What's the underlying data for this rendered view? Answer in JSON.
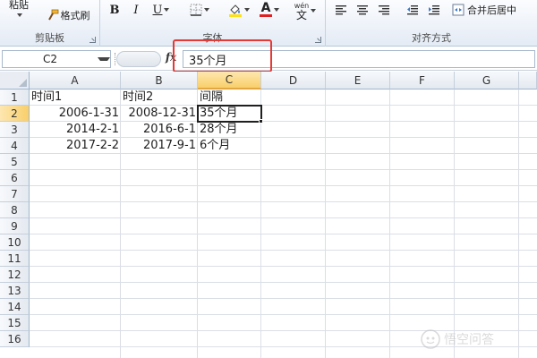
{
  "ribbon": {
    "paste_label": "粘贴",
    "format_painter_label": "格式刷",
    "clipboard_group": "剪贴板",
    "font_group": "字体",
    "bold": "B",
    "italic": "I",
    "underline": "U",
    "font_color_letter": "A",
    "wen": "wén",
    "wen_char": "文",
    "alignment_group": "对齐方式",
    "merge_center_label": "合并后居中",
    "colors": {
      "font_red": "#e02020",
      "highlight_yellow": "#ffe11a"
    }
  },
  "formula_bar": {
    "name_box": "C2",
    "fx": "fx",
    "value": "35个月"
  },
  "sheet": {
    "columns": [
      "A",
      "B",
      "C",
      "D",
      "E",
      "F",
      "G"
    ],
    "rows": [
      "1",
      "2",
      "3",
      "4",
      "5",
      "6",
      "7",
      "8",
      "9",
      "10",
      "11",
      "12",
      "13",
      "14",
      "15",
      "16"
    ],
    "selected_cell": "C2",
    "data": [
      [
        "时间1",
        "时间2",
        "间隔"
      ],
      [
        "2006-1-31",
        "2008-12-31",
        "35个月"
      ],
      [
        "2014-2-1",
        "2016-6-1",
        "28个月"
      ],
      [
        "2017-2-2",
        "2017-9-1",
        "6个月"
      ]
    ]
  },
  "watermark": "悟空问答"
}
